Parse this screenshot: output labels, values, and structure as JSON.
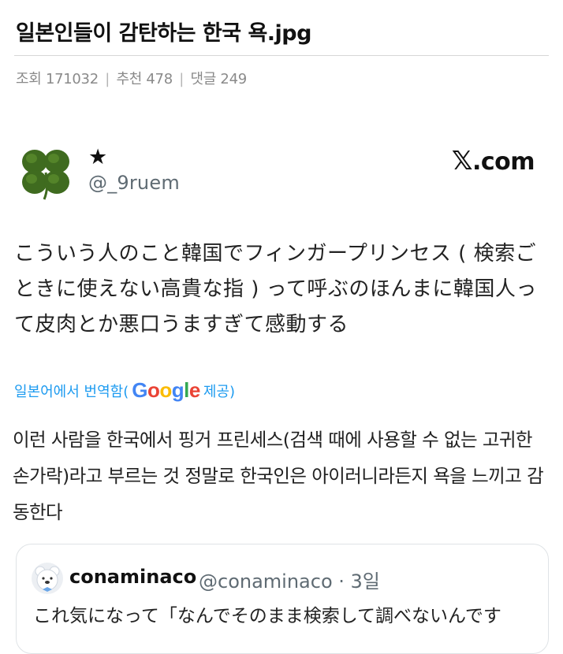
{
  "post": {
    "title": "일본인들이 감탄하는 한국 욕.jpg",
    "views": "조회 171032",
    "likes": "추천 478",
    "comments": "댓글 249",
    "separator": "|"
  },
  "tweet": {
    "display_name": "★",
    "handle": "@_9ruem",
    "source_site": ".com",
    "source_x_glyph": "𝕏",
    "text": "こういう人のこと韓国でフィンガープリンセス ( 検索ごときに使えない高貴な指 ) って呼ぶのほんまに韓国人って皮肉とか悪口うますぎて感動する",
    "translated_prefix": "일본어에서 번역함(",
    "google_letters": [
      "G",
      "o",
      "o",
      "g",
      "l",
      "e"
    ],
    "google_colors": [
      "#4285F4",
      "#EA4335",
      "#FBBC05",
      "#4285F4",
      "#34A853",
      "#EA4335"
    ],
    "translated_suffix": " 제공)",
    "translation": "이런 사람을 한국에서 핑거 프린세스(검색 때에 사용할 수 없는 고귀한 손가락)라고 부르는 것 정말로 한국인은 아이러니라든지 욕을 느끼고 감동한다",
    "avatar_icon": "four-leaf-clover-icon"
  },
  "quote": {
    "name": "conaminaco",
    "handle": "@conaminaco · 3일",
    "text": "これ気になって「なんでそのまま検索して調べないんです",
    "avatar_icon": "bear-avatar-icon"
  },
  "colors": {
    "link_blue": "#1d9bf0",
    "meta_gray": "#8a8a8a",
    "clover_green": "#3f6b1f"
  }
}
